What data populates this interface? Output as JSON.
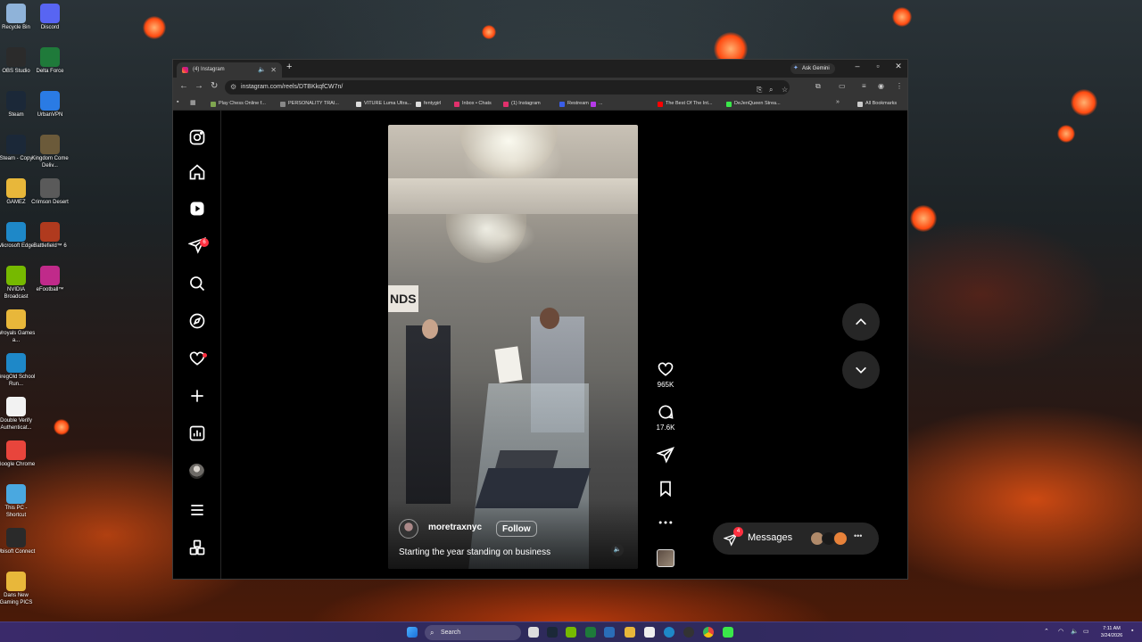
{
  "desktop": {
    "icons": [
      {
        "label": "Recycle Bin",
        "color": "#8fb3d9"
      },
      {
        "label": "Discord",
        "color": "#5865f2"
      },
      {
        "label": "OBS Studio",
        "color": "#2b2b2b"
      },
      {
        "label": "Delta Force",
        "color": "#1f7a3a"
      },
      {
        "label": "Steam",
        "color": "#1b2838"
      },
      {
        "label": "UrbanVPN",
        "color": "#2a7be4"
      },
      {
        "label": "Steam - Copy",
        "color": "#1b2838"
      },
      {
        "label": "Kingdom Come Deliv...",
        "color": "#6b5a3a"
      },
      {
        "label": "GAMEZ",
        "color": "#e8b73a"
      },
      {
        "label": "Crimson Desert",
        "color": "#5a5a5a"
      },
      {
        "label": "Microsoft Edge",
        "color": "#1e88c8"
      },
      {
        "label": "Battlefield™ 6",
        "color": "#b03a1e"
      },
      {
        "label": "NVIDIA Broadcast",
        "color": "#76b900"
      },
      {
        "label": "eFootball™",
        "color": "#c02a8a"
      },
      {
        "label": "Wroyals Games a...",
        "color": "#e8b73a"
      },
      {
        "label": "GregOld School Run...",
        "color": "#1e88c8"
      },
      {
        "label": "Double Verify Authenticat...",
        "color": "#f2f2f2"
      },
      {
        "label": "Google Chrome",
        "color": "#e8453c"
      },
      {
        "label": "This PC - Shortcut",
        "color": "#4aa8e0"
      },
      {
        "label": "Ubisoft Connect",
        "color": "#2a2a2a"
      },
      {
        "label": "Dans New Gaming PICS",
        "color": "#e8b73a"
      }
    ]
  },
  "browser": {
    "tab_title": "(4) Instagram",
    "new_tab": "+",
    "ask_gemini": "Ask Gemini",
    "url": "instagram.com/reels/DTBKkqfCW7n/",
    "bookmarks": [
      {
        "label": "Play Chess Online f...",
        "color": "#7fa650"
      },
      {
        "label": "PERSONALITY TRAI...",
        "color": "#888888"
      },
      {
        "label": "VITURE Luma Ultra...",
        "color": "#dddddd"
      },
      {
        "label": "fentygirl",
        "color": "#dddddd"
      },
      {
        "label": "Inbox • Chats",
        "color": "#e1306c"
      },
      {
        "label": "(1) Instagram",
        "color": "#e1306c"
      },
      {
        "label": "Restream",
        "color": "#3a5ee8"
      },
      {
        "label": "...",
        "color": "#b53ae8"
      },
      {
        "label": "The Best Of The Int...",
        "color": "#ff0000"
      },
      {
        "label": "DeJenQueen Strea...",
        "color": "#3ae84a"
      }
    ],
    "all_bookmarks": "All Bookmarks"
  },
  "instagram": {
    "notification_badge": "6",
    "reel": {
      "username": "moretraxnyc",
      "follow_label": "Follow",
      "caption": "Starting the year standing on business"
    },
    "actions": {
      "likes": "965K",
      "comments": "17.6K"
    },
    "messages": {
      "label": "Messages",
      "badge": "4",
      "avatar_colors": [
        "#b08a6a",
        "#1a1a1a",
        "#e8823a"
      ]
    }
  },
  "taskbar": {
    "search_placeholder": "Search",
    "time": "7:11 AM",
    "date": "3/24/2026"
  }
}
